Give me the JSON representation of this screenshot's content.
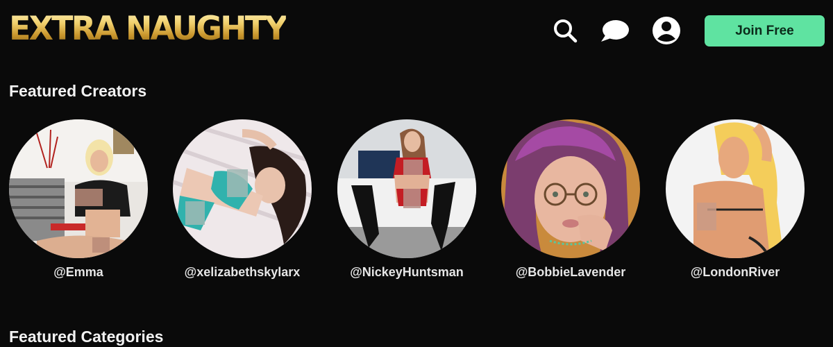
{
  "header": {
    "logo_text": "EXTRA NAUGHTY",
    "icons": [
      "search-icon",
      "chat-bubble-icon",
      "user-account-icon"
    ],
    "join_label": "Join Free"
  },
  "featured_creators": {
    "title": "Featured Creators",
    "items": [
      {
        "handle": "@Emma"
      },
      {
        "handle": "@xelizabethskylarx"
      },
      {
        "handle": "@NickeyHuntsman"
      },
      {
        "handle": "@BobbieLavender"
      },
      {
        "handle": "@LondonRiver"
      }
    ]
  },
  "featured_categories": {
    "title": "Featured Categories"
  },
  "colors": {
    "background": "#0a0a0a",
    "join_button": "#5fe3a1",
    "logo_gold": "#d9ae4a"
  }
}
